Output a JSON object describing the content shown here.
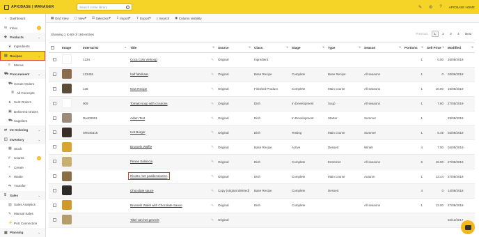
{
  "brand": {
    "name": "APICBASE | MANAGER"
  },
  "search": {
    "placeholder": "Search in the library"
  },
  "top_right": {
    "home_label": "APICBASE HOME"
  },
  "sidebar": {
    "items": [
      {
        "label": "Dashboard",
        "icon": "gauge-icon",
        "kind": "item"
      },
      {
        "label": "Inbox",
        "icon": "inbox-icon",
        "kind": "item",
        "badge": "1"
      },
      {
        "label": "Products",
        "icon": "tag-icon",
        "kind": "section"
      },
      {
        "label": "Ingredients",
        "icon": "leaf-icon",
        "kind": "sub"
      },
      {
        "label": "Recipes",
        "icon": "recipe-icon",
        "kind": "active"
      },
      {
        "label": "Menus",
        "icon": "menu-icon",
        "kind": "sub"
      },
      {
        "label": "Procurement",
        "icon": "cart-icon",
        "kind": "section"
      },
      {
        "label": "Create Orders",
        "icon": "cart-icon",
        "kind": "sub"
      },
      {
        "label": "All Concepts",
        "icon": "list-icon",
        "kind": "sub2"
      },
      {
        "label": "Sent Orders",
        "icon": "send-icon",
        "kind": "sub"
      },
      {
        "label": "Delivered Orders",
        "icon": "box-icon",
        "kind": "sub"
      },
      {
        "label": "Suppliers",
        "icon": "truck-icon",
        "kind": "sub"
      },
      {
        "label": "Int Ordering",
        "icon": "swap-icon",
        "kind": "section"
      },
      {
        "label": "Inventory",
        "icon": "layers-icon",
        "kind": "section"
      },
      {
        "label": "Stock",
        "icon": "stock-icon",
        "kind": "sub"
      },
      {
        "label": "Counts",
        "icon": "count-icon",
        "kind": "sub",
        "badge": "1"
      },
      {
        "label": "Create",
        "icon": "plus-icon",
        "kind": "sub"
      },
      {
        "label": "Waste",
        "icon": "trash-icon",
        "kind": "sub"
      },
      {
        "label": "Transfer",
        "icon": "transfer-icon",
        "kind": "sub"
      },
      {
        "label": "Sales",
        "icon": "dollar-icon",
        "kind": "section"
      },
      {
        "label": "Sales Analytics",
        "icon": "chart-icon",
        "kind": "sub"
      },
      {
        "label": "Manual Sales",
        "icon": "edit-icon",
        "kind": "sub"
      },
      {
        "label": "PoS Connection",
        "icon": "plug-icon",
        "kind": "sub"
      },
      {
        "label": "Planning",
        "icon": "calendar-icon",
        "kind": "section"
      }
    ]
  },
  "toolbar": {
    "buttons": [
      {
        "label": "Grid View",
        "icon": "grid-icon"
      },
      {
        "label": "New",
        "icon": "file-icon",
        "caret": true
      },
      {
        "label": "Selection",
        "icon": "check-list-icon",
        "caret": true
      },
      {
        "label": "Import",
        "icon": "import-icon",
        "caret": true
      },
      {
        "label": "Export",
        "icon": "export-icon",
        "caret": true
      },
      {
        "label": "Search",
        "icon": "search-icon"
      },
      {
        "label": "Column visibility",
        "icon": "eye-icon"
      }
    ]
  },
  "info": "Showing 1 to 50 of 166 entries",
  "pager": {
    "prev": "Previous",
    "pages": [
      "1",
      "2",
      "3",
      "4"
    ],
    "current": "1",
    "next": "Next"
  },
  "table": {
    "columns": [
      "",
      "Image",
      "Internal ID",
      "Title",
      "Source",
      "Class",
      "Stage",
      "Type",
      "Season",
      "Portions",
      "Sell Price",
      "Modified"
    ],
    "rows": [
      {
        "image": "",
        "id": "1234",
        "title": "Coca Cola Verkoop",
        "source": "Original",
        "class": "Ingredient",
        "stage": "",
        "type": "",
        "season": "",
        "portions": "1",
        "price": "0.00",
        "modified": "26/08/2019"
      },
      {
        "image": "#8b6a4e",
        "id": "123456",
        "title": "half fabrikaat",
        "source": "Original",
        "class": "Base Recipe",
        "stage": "Complete",
        "type": "Base Recipe",
        "season": "All seasons",
        "portions": "1",
        "price": "0",
        "modified": "03/06/2018"
      },
      {
        "image": "#5d4b3a",
        "id": "138",
        "title": "New Recipe",
        "source": "Original",
        "class": "Finished Product",
        "stage": "Complete",
        "type": "Main course",
        "season": "All seasons",
        "portions": "1",
        "price": "10.00",
        "modified": "16/05/2019"
      },
      {
        "image": "",
        "id": "009",
        "title": "Tomato soup with croutons",
        "source": "Original",
        "class": "Dish",
        "stage": "In Development",
        "type": "Soup",
        "season": "All seasons",
        "portions": "1",
        "price": "7.80",
        "modified": "27/08/2019"
      },
      {
        "image": "#9c8b7a",
        "id": "Ra400001",
        "title": "Adam Test",
        "source": "Original",
        "class": "Dish",
        "stage": "In Development",
        "type": "Starter",
        "season": "Summer",
        "portions": "1",
        "price": "",
        "modified": "29/08/2019"
      },
      {
        "image": "#3a2f28",
        "id": "SR545315",
        "title": "Hot Burger",
        "source": "Original",
        "class": "Dish",
        "stage": "Testing",
        "type": "Main course",
        "season": "Summer",
        "portions": "1",
        "price": "5.45",
        "modified": "02/08/2019"
      },
      {
        "image": "#d9a531",
        "id": "",
        "title": "Brussels Waffle",
        "source": "Original",
        "class": "Base Recipe",
        "stage": "Active",
        "type": "Dessert",
        "season": "Winter",
        "portions": "4",
        "price": "7.00",
        "modified": "04/09/2019"
      },
      {
        "image": "#c8b070",
        "id": "",
        "title": "Penne Salsiccia",
        "source": "Original",
        "class": "Dish",
        "stage": "Complete",
        "type": "Entremet",
        "season": "All seasons",
        "portions": "6",
        "price": "15.00",
        "modified": "27/08/2019"
      },
      {
        "image": "#8a6d45",
        "id": "",
        "title": "Risotto met paddenstoelen",
        "source": "Original",
        "class": "Dish",
        "stage": "Complete",
        "type": "Main course",
        "season": "Autumn",
        "portions": "1",
        "price": "13.44",
        "modified": "27/08/2019",
        "highlight": true
      },
      {
        "image": "#2e2a26",
        "id": "",
        "title": "Chocolate sauce",
        "source": "Copy (original deleted)",
        "class": "Base Recipe",
        "stage": "Complete",
        "type": "Dessert",
        "season": "",
        "portions": "4",
        "price": "0",
        "modified": "14/08/2018"
      },
      {
        "image": "#d19a2a",
        "id": "",
        "title": "Brussels Wafel with Chocolate Sauce",
        "source": "Original",
        "class": "Dish",
        "stage": "Complete",
        "type": "",
        "season": "All seasons",
        "portions": "1",
        "price": "12.00",
        "modified": "27/08/2019"
      },
      {
        "image": "#b59c6a",
        "id": "",
        "title": "Tikel van het gerecht",
        "source": "Original",
        "class": "",
        "stage": "",
        "type": "",
        "season": "",
        "portions": "",
        "price": "",
        "modified": "04/12/2017"
      }
    ]
  },
  "colors": {
    "brand_yellow": "#f5d327",
    "highlight_red": "#e53935",
    "badge_orange": "#f5b81c"
  }
}
